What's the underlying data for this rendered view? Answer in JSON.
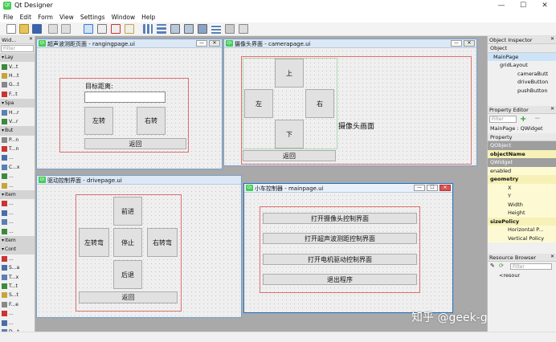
{
  "app": {
    "title": "Qt Designer",
    "icon": "Qt"
  },
  "menu": [
    "File",
    "Edit",
    "Form",
    "View",
    "Settings",
    "Window",
    "Help"
  ],
  "widget_box": {
    "title": "Wid...",
    "filter": "Filter",
    "rows": [
      {
        "label": "Lay",
        "cat": true
      },
      {
        "label": "V...t",
        "cat": false
      },
      {
        "label": "H...t",
        "cat": false
      },
      {
        "label": "G...t",
        "cat": false
      },
      {
        "label": "F...t",
        "cat": false
      },
      {
        "label": "Spa",
        "cat": true
      },
      {
        "label": "H...r",
        "cat": false
      },
      {
        "label": "V...r",
        "cat": false
      },
      {
        "label": "But",
        "cat": true
      },
      {
        "label": "P...n",
        "cat": false
      },
      {
        "label": "T...n",
        "cat": false
      },
      {
        "label": "...",
        "cat": false
      },
      {
        "label": "C...x",
        "cat": false
      },
      {
        "label": "...",
        "cat": false
      },
      {
        "label": "...",
        "cat": false
      },
      {
        "label": "Item",
        "cat": true
      },
      {
        "label": "...",
        "cat": false
      },
      {
        "label": "...",
        "cat": false
      },
      {
        "label": "...",
        "cat": false
      },
      {
        "label": "...",
        "cat": false
      },
      {
        "label": "Item",
        "cat": true
      },
      {
        "label": "Cont",
        "cat": true
      },
      {
        "label": "...",
        "cat": false
      },
      {
        "label": "S...a",
        "cat": false
      },
      {
        "label": "T...x",
        "cat": false
      },
      {
        "label": "T...t",
        "cat": false
      },
      {
        "label": "S...t",
        "cat": false
      },
      {
        "label": "F...e",
        "cat": false
      },
      {
        "label": "...",
        "cat": false
      },
      {
        "label": "...",
        "cat": false
      },
      {
        "label": "D...t",
        "cat": false
      }
    ]
  },
  "windows": {
    "ranging": {
      "title": "超声波测距页面 - rangingpage.ui",
      "label": "目标距离:",
      "left": "左转",
      "right": "右转",
      "back": "返回"
    },
    "camera": {
      "title": "摄像头界面 - camerapage.ui",
      "up": "上",
      "left": "左",
      "right": "右",
      "down": "下",
      "label": "摄像头画面",
      "back": "返回"
    },
    "drive": {
      "title": "驱动控制界面 - drivepage.ui",
      "forward": "前进",
      "left": "左转弯",
      "stop": "停止",
      "right": "右转弯",
      "backward": "后退",
      "back": "返回"
    },
    "main": {
      "title": "小车控制器 - mainpage.ui",
      "btn1": "打开摄像头控制界面",
      "btn2": "打开超声波测距控制界面",
      "btn3": "打开电机驱动控制界面",
      "btn4": "退出程序"
    }
  },
  "object_inspector": {
    "title": "Object Inspector",
    "header": "Object",
    "items": [
      "MainPage",
      "gridLayout",
      "cameraButt",
      "driveButton",
      "pushButton"
    ]
  },
  "property_editor": {
    "title": "Property Editor",
    "filter": "Filter",
    "context": "MainPage : QWidget",
    "header": "Property",
    "rows": [
      {
        "label": "QObject",
        "style": "cat"
      },
      {
        "label": "objectName",
        "style": "yel2"
      },
      {
        "label": "QWidget",
        "style": "cat"
      },
      {
        "label": "enabled",
        "style": "yel"
      },
      {
        "label": "geometry",
        "style": "yel2"
      },
      {
        "label": "X",
        "style": "yel"
      },
      {
        "label": "Y",
        "style": "yel"
      },
      {
        "label": "Width",
        "style": "yel"
      },
      {
        "label": "Height",
        "style": "yel"
      },
      {
        "label": "sizePolicy",
        "style": "yel2"
      },
      {
        "label": "Horizontal P...",
        "style": "yel"
      },
      {
        "label": "Vertical Policy",
        "style": "yel"
      }
    ]
  },
  "resource_browser": {
    "title": "Resource Browser",
    "filter": "Filter",
    "item": "<resour"
  },
  "watermark": "知乎 @geek-guy"
}
